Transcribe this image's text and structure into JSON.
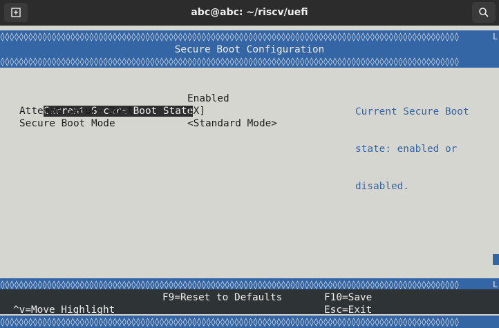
{
  "window": {
    "title": "abc@abc: ~/riscv/uefi",
    "new_tab_icon": "new-tab-icon",
    "search_icon": "search-icon"
  },
  "border_pattern": "◊◊◊◊◊◊◊◊◊◊◊◊◊◊◊◊◊◊◊◊◊◊◊◊◊◊◊◊◊◊◊◊◊◊◊◊◊◊◊◊◊◊◊◊◊◊◊◊◊◊◊◊◊◊◊◊◊◊◊◊◊◊◊◊◊◊◊◊◊◊◊◊◊◊◊◊◊◊◊◊◊◊◊◊◊◊◊◊◊◊◊◊◊◊◊◊◊◊",
  "border_edge": "L",
  "header": {
    "title": "Secure Boot Configuration"
  },
  "settings": [
    {
      "label": "Current Secure Boot State",
      "value": "Enabled"
    },
    {
      "label": "Attempt Secure Boot",
      "value": "[X]"
    },
    {
      "label": "Secure Boot Mode",
      "value": "<Standard Mode>"
    }
  ],
  "help": {
    "line1": "Current Secure Boot",
    "line2": "state: enabled or",
    "line3": "disabled."
  },
  "footer": {
    "f9": "F9=Reset to Defaults",
    "f10": "F10=Save",
    "move": "^v=Move Highlight",
    "esc": "Esc=Exit"
  },
  "colors": {
    "accent_blue": "#3465a4",
    "background": "#d6d6d0",
    "footer_bg": "#2e3436"
  }
}
